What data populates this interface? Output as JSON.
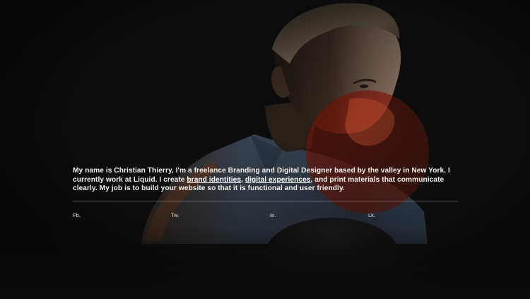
{
  "intro": {
    "part1": "My name is Christian Thierry, I'm a freelance Branding and Digital Designer based by the valley in New York. I currently work at Liquid. I create ",
    "link_brand": "brand identities",
    "separator": ", ",
    "link_digital": "digital experiences",
    "part2": ", and print materials that communicate clearly. My job is to build your website so that it is functional and user friendly."
  },
  "social": {
    "facebook": "Fb.",
    "twitter": "Tw.",
    "instagram": "In.",
    "linkedin": "Lk."
  },
  "colors": {
    "background": "#0b0b0c",
    "accent_circle": "#e2391d",
    "text": "#f4f1ec"
  }
}
